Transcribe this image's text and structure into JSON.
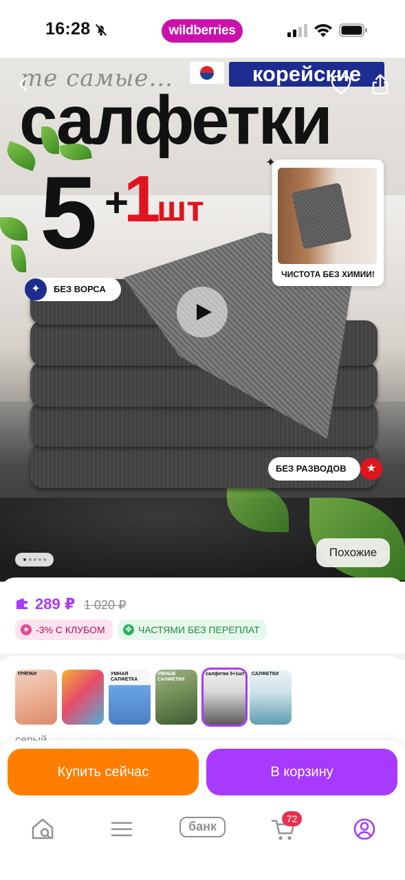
{
  "status_bar": {
    "time": "16:28",
    "brand": "wildberries"
  },
  "hero": {
    "subtitle": "те самые...",
    "korean_tag": "корейские",
    "title": "салфетки",
    "count_main": "5",
    "count_plus": "+",
    "count_bonus": "1",
    "count_unit": "шт",
    "badge_no_lint": "БЕЗ ВОРСА",
    "inset_caption": "ЧИСТОТА БЕЗ ХИМИИ!",
    "badge_no_streaks": "БЕЗ РАЗВОДОВ",
    "similar_button": "Похожие",
    "slide_count": 5,
    "active_slide": 1
  },
  "price": {
    "current": "289 ₽",
    "old": "1 020 ₽",
    "promo_club": "-3% С КЛУБОМ",
    "promo_split": "ЧАСТЯМИ БЕЗ ПЕРЕПЛАТ"
  },
  "variants": {
    "items": [
      {
        "label": "ТРЯПКИ",
        "colors": [
          "#e9a98a",
          "#f3d2c2"
        ]
      },
      {
        "label": "",
        "colors": [
          "#e74c6a",
          "#f2b233"
        ]
      },
      {
        "label": "УМНАЯ САЛФЕТКА",
        "colors": [
          "#6aa5e6",
          "#4b7fc4"
        ]
      },
      {
        "label": "УМНЫЕ САЛФЕТКИ",
        "colors": [
          "#6f8a52",
          "#3e5a36"
        ]
      },
      {
        "label": "салфетки 5+1шт",
        "colors": [
          "#d9d9d9",
          "#5b5b5b"
        ]
      },
      {
        "label": "САЛФЕТКИ",
        "colors": [
          "#cfe3ea",
          "#5f9eb0"
        ]
      }
    ],
    "selected_index": 4,
    "color_label": "серый"
  },
  "actions": {
    "buy_now": "Купить сейчас",
    "add_to_cart": "В корзину"
  },
  "tabbar": {
    "bank": "банк",
    "cart_count": "72"
  },
  "colors": {
    "brand": "#cb11ab",
    "accent_purple": "#a73afd",
    "buy_orange": "#ff7e00",
    "badge_red": "#e8304f"
  }
}
